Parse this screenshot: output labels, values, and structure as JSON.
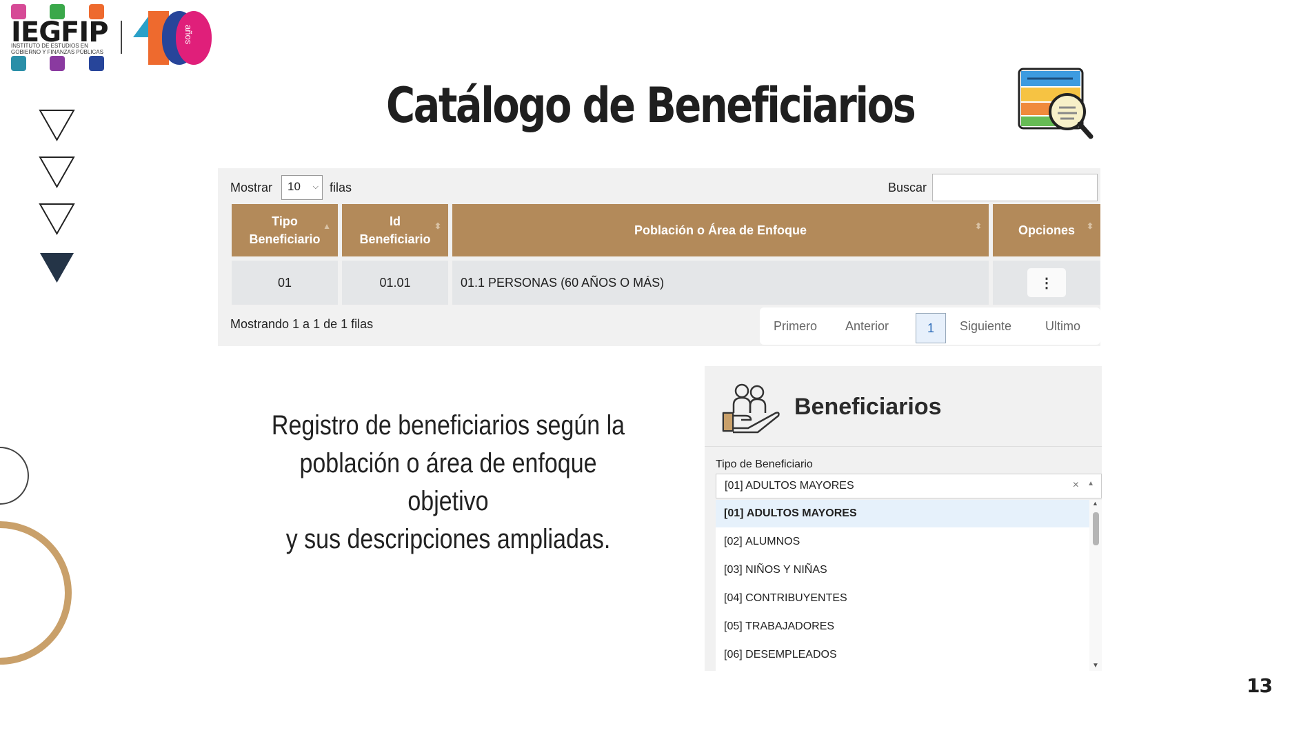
{
  "logo": {
    "name": "IEGFIP",
    "subtitle": "INSTITUTO DE ESTUDIOS EN GOBIERNO Y FINANZAS PÚBLICAS",
    "anniversary_word": "años"
  },
  "slide": {
    "title": "Catálogo de Beneficiarios",
    "page_number": "13",
    "caption_lines": [
      "Registro de beneficiarios según la",
      "población o área de enfoque objetivo",
      "y sus descripciones ampliadas."
    ]
  },
  "table": {
    "show_label": "Mostrar",
    "page_size": "10",
    "rows_label": "filas",
    "search_label": "Buscar",
    "columns": [
      {
        "line1": "Tipo",
        "line2": "Beneficiario"
      },
      {
        "line1": "Id",
        "line2": "Beneficiario"
      },
      {
        "line1": "Población o Área de Enfoque",
        "line2": ""
      },
      {
        "line1": "Opciones",
        "line2": ""
      }
    ],
    "rows": [
      {
        "tipo": "01",
        "id": "01.01",
        "poblacion": "01.1 PERSONAS (60 AÑOS O MÁS)",
        "options": "⋮"
      }
    ],
    "info": "Mostrando 1 a 1 de 1 filas",
    "pagination": {
      "first": "Primero",
      "prev": "Anterior",
      "current": "1",
      "next": "Siguiente",
      "last": "Ultimo"
    }
  },
  "form": {
    "title": "Beneficiarios",
    "field_label": "Tipo de Beneficiario",
    "selected_value": "[01] ADULTOS MAYORES",
    "clear_symbol": "×",
    "options": [
      {
        "code": "[01]",
        "name": "ADULTOS MAYORES"
      },
      {
        "code": "[02]",
        "name": "ALUMNOS"
      },
      {
        "code": "[03]",
        "name": "NIÑOS Y NIÑAS"
      },
      {
        "code": "[04]",
        "name": "CONTRIBUYENTES"
      },
      {
        "code": "[05]",
        "name": "TRABAJADORES"
      },
      {
        "code": "[06]",
        "name": "DESEMPLEADOS"
      }
    ]
  },
  "colors": {
    "header_bg": "#b38a5a",
    "accent_dark": "#243447",
    "ring": "#c9a06a"
  }
}
